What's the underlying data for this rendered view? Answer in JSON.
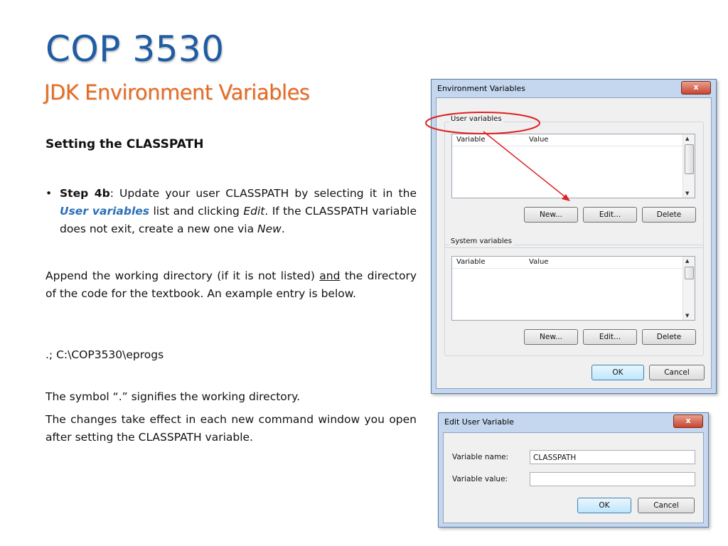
{
  "slide": {
    "title": "COP 3530",
    "subtitle": "JDK Environment Variables",
    "heading": "Setting the CLASSPATH",
    "bullet": {
      "marker": "•",
      "step_label": "Step 4b",
      "text_a": ":  Update your user CLASSPATH by selecting it in the ",
      "accent": "User variables",
      "text_b": " list and clicking ",
      "edit_word": "Edit",
      "text_c": ".  If the CLASSPATH variable does not exit, create a new one via ",
      "new_word": "New",
      "text_d": "."
    },
    "para1": {
      "text_a": "Append the working directory (if it is not listed) ",
      "underlined": "and",
      "text_b": " the directory of the code for the textbook.  An example entry is below."
    },
    "example_entry": ".; C:\\COP3530\\eprogs",
    "para3": "The symbol “.” signifies the working directory.",
    "para4": "The changes take effect in each new command window you open after setting the CLASSPATH variable."
  },
  "env_dialog": {
    "title": "Environment Variables",
    "close_label": "x",
    "user_group_label": "User variables",
    "system_group_label": "System variables",
    "col_variable": "Variable",
    "col_value": "Value",
    "new_label": "New...",
    "edit_label": "Edit...",
    "delete_label": "Delete",
    "ok_label": "OK",
    "cancel_label": "Cancel",
    "highlight_color": "#e02020"
  },
  "edit_dialog": {
    "title": "Edit User Variable",
    "close_label": "x",
    "name_label": "Variable name:",
    "name_value": "CLASSPATH",
    "value_label": "Variable value:",
    "value_value": "",
    "ok_label": "OK",
    "cancel_label": "Cancel"
  }
}
